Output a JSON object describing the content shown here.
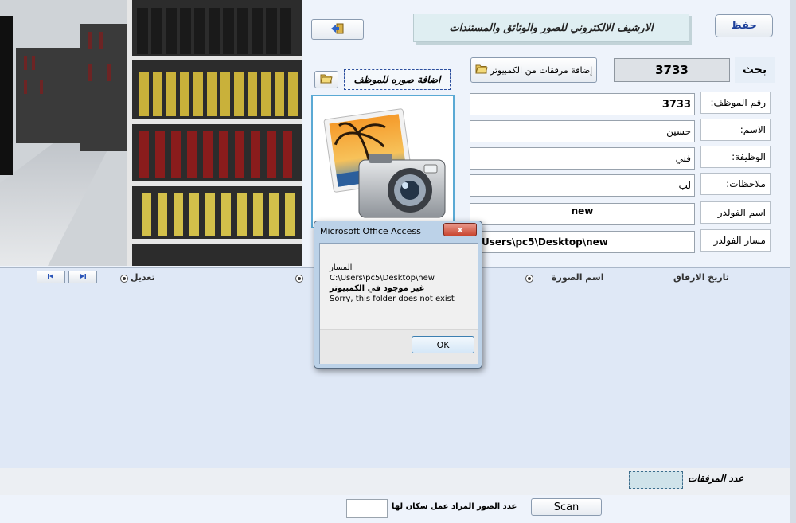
{
  "header": {
    "save_label": "حفظ",
    "title": "الارشيف الالكتروني للصور والوثائق والمستندات"
  },
  "search": {
    "label": "بحث",
    "value": "3733"
  },
  "toolbar": {
    "add_files_label": "إضافة مرفقات من الكمبيوتر",
    "add_photo_label": "اضافة صوره للموظف"
  },
  "form": {
    "fields": [
      {
        "label": "رقم الموظف:",
        "value": "3733"
      },
      {
        "label": "الاسم:",
        "value": "حسين"
      },
      {
        "label": "الوظيفة:",
        "value": "فني"
      },
      {
        "label": "ملاحظات:",
        "value": "لب"
      },
      {
        "label": "اسم الفولدر",
        "value": "new"
      },
      {
        "label": "مسار الفولدر",
        "value": "Users\\pc5\\Desktop\\new"
      }
    ]
  },
  "attachments_table": {
    "columns": [
      "تاريخ الارفاق",
      "اسم الصورة",
      "تعديل"
    ]
  },
  "footer": {
    "attach_count_label": "عدد المرفقات",
    "scan_count_label": "عدد الصور المراد عمل سكان لها",
    "scan_label": "Scan"
  },
  "dialog": {
    "title": "Microsoft Office Access",
    "lines": [
      "المسار",
      "C:\\Users\\pc5\\Desktop\\new",
      "غير موجود في الكمبيوتر",
      "Sorry, this folder does not exist"
    ],
    "ok_label": "OK",
    "close_glyph": "x"
  },
  "icons": [
    "exit-icon",
    "folder-open-icon",
    "photo-camera-icon",
    "nav-first-icon",
    "nav-last-icon"
  ]
}
